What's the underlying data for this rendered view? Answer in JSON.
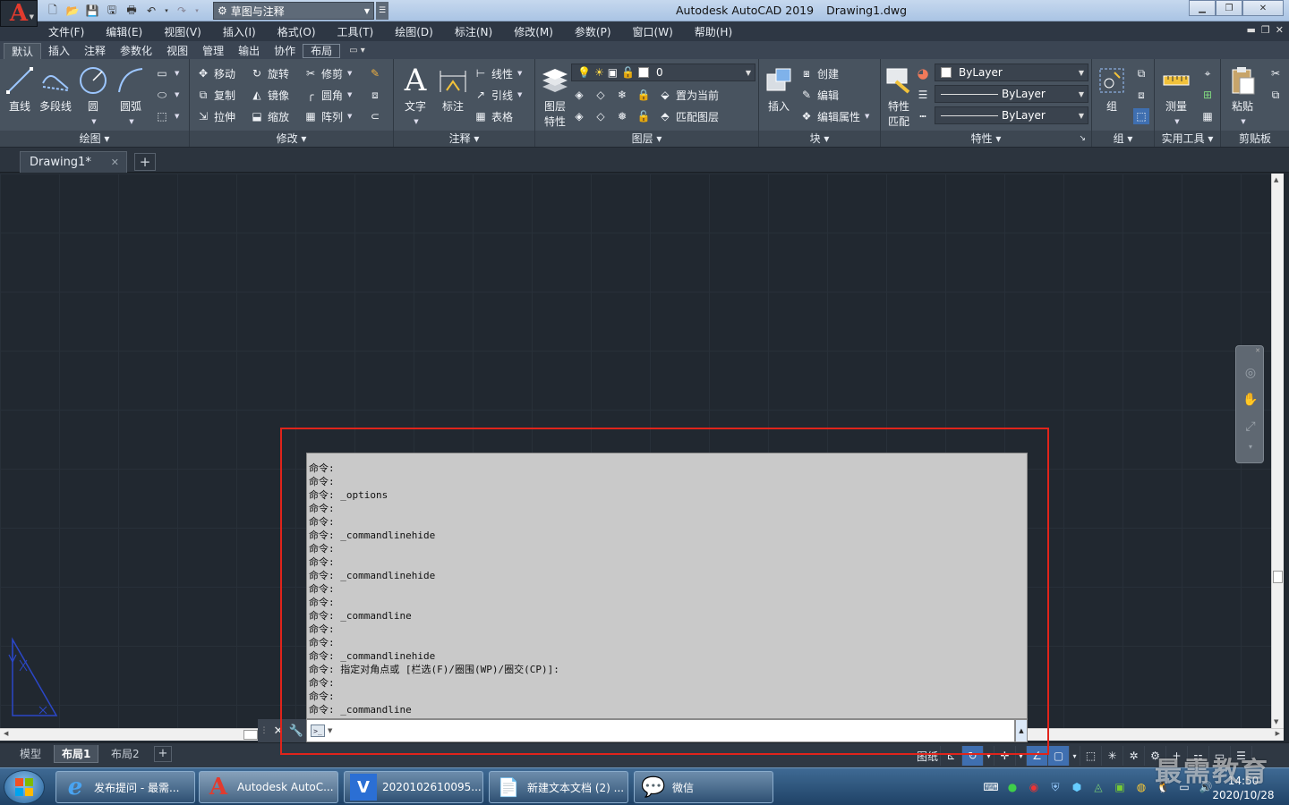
{
  "titlebar": {
    "workspace": "草图与注释",
    "app_name": "Autodesk AutoCAD 2019",
    "document": "Drawing1.dwg"
  },
  "menubar": {
    "items": [
      "文件(F)",
      "编辑(E)",
      "视图(V)",
      "插入(I)",
      "格式(O)",
      "工具(T)",
      "绘图(D)",
      "标注(N)",
      "修改(M)",
      "参数(P)",
      "窗口(W)",
      "帮助(H)"
    ]
  },
  "ribbon_tabs": [
    "默认",
    "插入",
    "注释",
    "参数化",
    "视图",
    "管理",
    "输出",
    "协作",
    "布局"
  ],
  "ribbon": {
    "draw": {
      "title": "绘图",
      "line": "直线",
      "polyline": "多段线",
      "circle": "圆",
      "arc": "圆弧"
    },
    "modify": {
      "title": "修改",
      "move": "移动",
      "rotate": "旋转",
      "trim": "修剪",
      "copy": "复制",
      "mirror": "镜像",
      "fillet": "圆角",
      "stretch": "拉伸",
      "scale": "缩放",
      "array": "阵列"
    },
    "annotation": {
      "title": "注释",
      "text": "文字",
      "dimension": "标注",
      "linear": "线性",
      "leader": "引线",
      "table": "表格"
    },
    "layers": {
      "title": "图层",
      "layer_properties_1": "图层",
      "layer_properties_2": "特性",
      "current_layer": "0",
      "make_current": "置为当前",
      "match_layer": "匹配图层"
    },
    "block": {
      "title": "块",
      "insert": "插入",
      "create": "创建",
      "edit": "编辑",
      "edit_attributes": "编辑属性"
    },
    "properties": {
      "title": "特性",
      "match_1": "特性",
      "match_2": "匹配",
      "color": "ByLayer",
      "linetype": "ByLayer",
      "lineweight": "ByLayer"
    },
    "groups": {
      "title": "组",
      "group": "组"
    },
    "utilities": {
      "title": "实用工具",
      "measure": "测量"
    },
    "clipboard": {
      "title": "剪贴板",
      "paste": "粘贴"
    }
  },
  "file_tabs": {
    "drawing": "Drawing1*"
  },
  "command": {
    "history": [
      "命令:",
      "命令:",
      "命令: _options",
      "命令:",
      "命令:",
      "命令: _commandlinehide",
      "命令:",
      "命令:",
      "命令: _commandlinehide",
      "命令:",
      "命令:",
      "命令: _commandline",
      "命令:",
      "命令:",
      "命令: _commandlinehide",
      "命令: 指定对角点或 [栏选(F)/圈围(WP)/圈交(CP)]:",
      "命令:",
      "命令:",
      "命令: _commandline"
    ],
    "input_value": ""
  },
  "layout_tabs": [
    "模型",
    "布局1",
    "布局2"
  ],
  "status": {
    "paper": "图纸"
  },
  "taskbar": {
    "tasks": [
      "发布提问 - 最需...",
      "Autodesk AutoC...",
      "2020102610095...",
      "新建文本文档 (2) ...",
      "微信"
    ],
    "time": "14:50",
    "date": "2020/10/28"
  },
  "watermark": "最需教育",
  "colors": {
    "highlight": "#e0241b",
    "canvas": "#212830",
    "ribbon": "#48535f"
  }
}
